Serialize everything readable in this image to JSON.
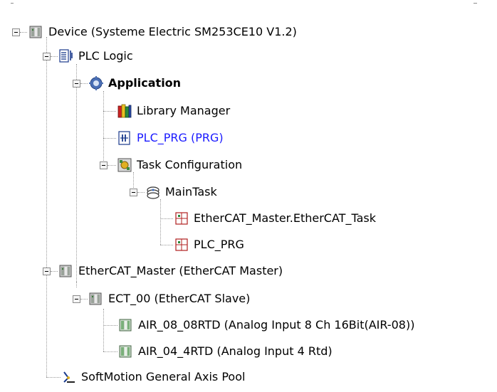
{
  "tree": {
    "device": {
      "label": "Device (Systeme Electric SM253CE10 V1.2)",
      "icon": "device-icon"
    },
    "plc_logic": {
      "label": "PLC Logic",
      "icon": "plc-logic-icon"
    },
    "application": {
      "label": "Application",
      "icon": "gear-icon"
    },
    "library_manager": {
      "label": "Library Manager",
      "icon": "library-books-icon"
    },
    "plc_prg": {
      "label": "PLC_PRG (PRG)",
      "icon": "pou-icon"
    },
    "task_configuration": {
      "label": "Task Configuration",
      "icon": "task-configuration-icon"
    },
    "main_task": {
      "label": "MainTask",
      "icon": "task-icon"
    },
    "ethercat_task_call": {
      "label": "EtherCAT_Master.EtherCAT_Task",
      "icon": "program-call-icon"
    },
    "plc_prg_call": {
      "label": "PLC_PRG",
      "icon": "program-call-icon"
    },
    "ethercat_master": {
      "label": "EtherCAT_Master (EtherCAT Master)",
      "icon": "device-icon"
    },
    "ect_00": {
      "label": "ECT_00 (EtherCAT Slave)",
      "icon": "device-icon"
    },
    "air_08": {
      "label": "AIR_08_08RTD (Analog  Input 8 Ch 16Bit(AIR-08))",
      "icon": "device-green-icon"
    },
    "air_04": {
      "label": "AIR_04_4RTD (Analog  Input 4 Rtd)",
      "icon": "device-green-icon"
    },
    "softmotion": {
      "label": "SoftMotion General Axis Pool",
      "icon": "axis-pool-icon"
    }
  },
  "colors": {
    "link_text": "#1a1aff",
    "connector": "#9a9a9a",
    "background": "#ffffff"
  }
}
